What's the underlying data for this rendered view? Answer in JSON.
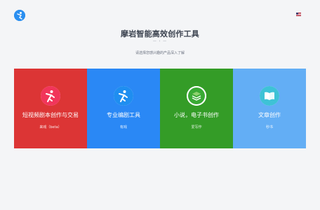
{
  "header": {
    "logo_icon": "logo-icon",
    "language_flag_icon": "us-flag-icon"
  },
  "hero": {
    "title": "摩岩智能高效创作工具",
    "divider": "— ‹ —",
    "subtitle": "请选择您感兴趣的产品深入了解"
  },
  "cards": [
    {
      "title": "短视频剧本创作与交易",
      "tag": "来戏（beta）",
      "color": "#dc3535",
      "icon": "dancer-icon"
    },
    {
      "title": "专业编剧工具",
      "tag": "有戏",
      "color": "#2a88f5",
      "icon": "film-reel-icon"
    },
    {
      "title": "小说，电子书创作",
      "tag": "爱写作",
      "color": "#349c27",
      "icon": "stacked-books-icon"
    },
    {
      "title": "文章创作",
      "tag": "秒书",
      "color": "#63aef5",
      "icon": "open-book-icon"
    }
  ]
}
